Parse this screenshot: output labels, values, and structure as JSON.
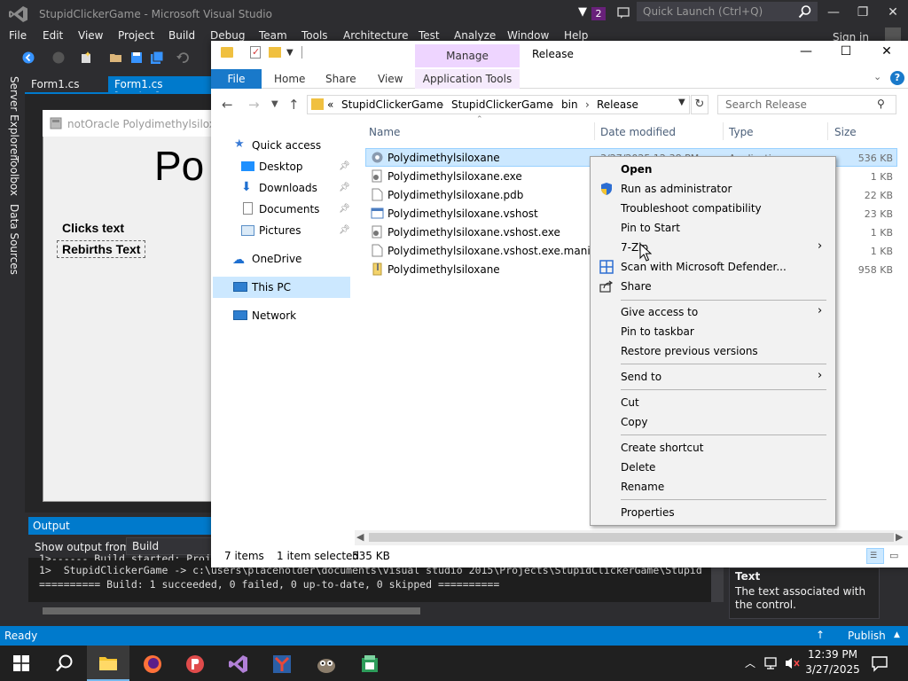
{
  "vs": {
    "title": "StupidClickerGame - Microsoft Visual Studio",
    "notification_count": "2",
    "quick_launch_placeholder": "Quick Launch (Ctrl+Q)",
    "menu": [
      "File",
      "Edit",
      "View",
      "Project",
      "Build",
      "Debug",
      "Team",
      "Tools",
      "Architecture",
      "Test",
      "Analyze",
      "Window",
      "Help"
    ],
    "sign_in": "Sign in",
    "side_panels": [
      "Server Explorer",
      "Toolbox",
      "Data Sources"
    ],
    "tabs": [
      "Form1.cs",
      "Form1.cs [Design]"
    ],
    "form": {
      "title": "notOracle Polydimethylsiloxane",
      "big_label": "Po",
      "clicks_label": "Clicks text",
      "rebirths_label": "Rebirths Text"
    },
    "output": {
      "header": "Output",
      "show_from_label": "Show output from:",
      "show_from_value": "Build",
      "lines": [
        "1>------ Build started: Project: StupidClickerGame, Configuration: Release Any CPU ------",
        "1>  StupidClickerGame -> c:\\users\\placeholder\\documents\\visual studio 2015\\Projects\\StupidClickerGame\\Stupid",
        "========== Build: 1 succeeded, 0 failed, 0 up-to-date, 0 skipped =========="
      ]
    },
    "properties": {
      "title": "Text",
      "description": "The text associated with the control."
    },
    "status": {
      "ready": "Ready",
      "publish": "Publish"
    }
  },
  "explorer": {
    "title": "Release",
    "contextual_tab_group": "Manage",
    "tabs": {
      "file": "File",
      "home": "Home",
      "share": "Share",
      "view": "View",
      "app_tools": "Application Tools"
    },
    "breadcrumb": {
      "overflow": "«",
      "parts": [
        "StupidClickerGame",
        "StupidClickerGame",
        "bin",
        "Release"
      ]
    },
    "search_placeholder": "Search Release",
    "nav": {
      "quick_access": "Quick access",
      "desktop": "Desktop",
      "downloads": "Downloads",
      "documents": "Documents",
      "pictures": "Pictures",
      "onedrive": "OneDrive",
      "this_pc": "This PC",
      "network": "Network"
    },
    "columns": {
      "name": "Name",
      "date": "Date modified",
      "type": "Type",
      "size": "Size"
    },
    "files": [
      {
        "name": "Polydimethylsiloxane",
        "date": "3/27/2025 12:38 PM",
        "type": "Application",
        "size": "536 KB"
      },
      {
        "name": "Polydimethylsiloxane.exe",
        "size": "1 KB"
      },
      {
        "name": "Polydimethylsiloxane.pdb",
        "size": "22 KB"
      },
      {
        "name": "Polydimethylsiloxane.vshost",
        "size": "23 KB"
      },
      {
        "name": "Polydimethylsiloxane.vshost.exe",
        "size": "1 KB"
      },
      {
        "name": "Polydimethylsiloxane.vshost.exe.manifest",
        "size": "1 KB"
      },
      {
        "name": "Polydimethylsiloxane",
        "size": "958 KB"
      }
    ],
    "status": {
      "items": "7 items",
      "selected": "1 item selected",
      "size": "535 KB"
    }
  },
  "context_menu": {
    "open": "Open",
    "run_admin": "Run as administrator",
    "troubleshoot": "Troubleshoot compatibility",
    "pin_start": "Pin to Start",
    "seven_zip": "7-Zip",
    "defender": "Scan with Microsoft Defender...",
    "share": "Share",
    "give_access": "Give access to",
    "pin_taskbar": "Pin to taskbar",
    "restore": "Restore previous versions",
    "send_to": "Send to",
    "cut": "Cut",
    "copy": "Copy",
    "create_shortcut": "Create shortcut",
    "delete": "Delete",
    "rename": "Rename",
    "properties": "Properties"
  },
  "taskbar": {
    "time": "12:39 PM",
    "date": "3/27/2025"
  },
  "colors": {
    "vs_accent": "#007acc",
    "explorer_select": "#cce8ff",
    "manage_tab": "#eed5ff"
  }
}
